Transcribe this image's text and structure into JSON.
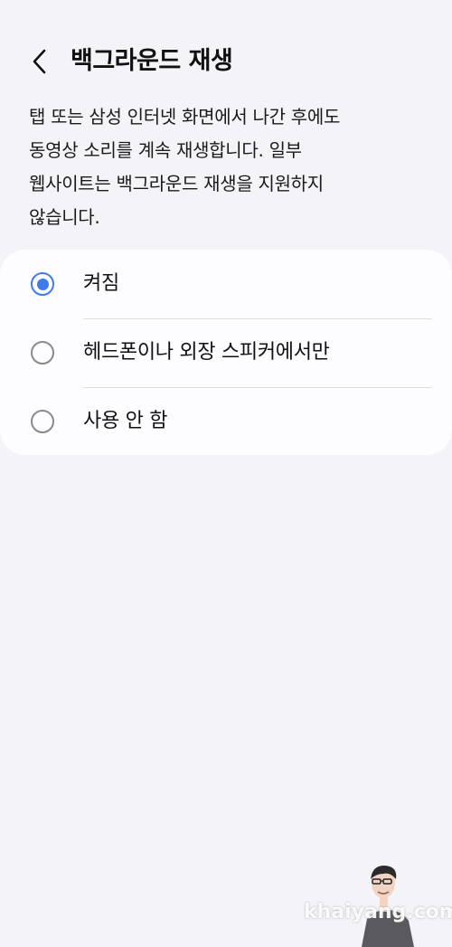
{
  "header": {
    "title": "백그라운드 재생",
    "back_icon": "chevron-left-icon"
  },
  "description": {
    "lines": [
      "탭 또는 삼성 인터넷 화면에서 나간 후에도",
      "동영상 소리를 계속 재생합니다. 일부",
      "웹사이트는 백그라운드 재생을 지원하지",
      "않습니다."
    ]
  },
  "options": [
    {
      "label": "켜짐",
      "selected": true
    },
    {
      "label": "헤드폰이나 외장 스피커에서만",
      "selected": false
    },
    {
      "label": "사용 안 함",
      "selected": false
    }
  ],
  "colors": {
    "accent": "#3e7bf0",
    "background": "#f4f3f8",
    "card": "#fdfcff"
  },
  "watermark": {
    "text": "khaiyang.com"
  }
}
